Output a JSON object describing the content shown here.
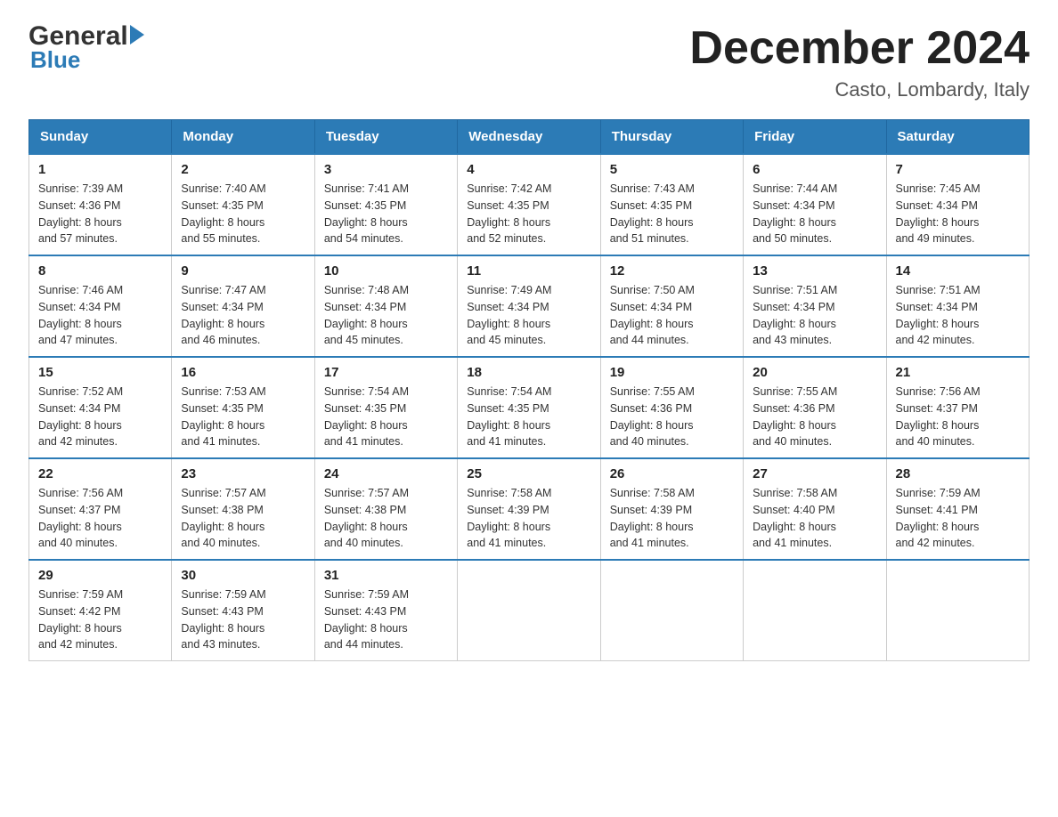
{
  "logo": {
    "general": "General",
    "blue": "Blue"
  },
  "title": {
    "month_year": "December 2024",
    "location": "Casto, Lombardy, Italy"
  },
  "headers": [
    "Sunday",
    "Monday",
    "Tuesday",
    "Wednesday",
    "Thursday",
    "Friday",
    "Saturday"
  ],
  "weeks": [
    [
      {
        "day": "1",
        "sunrise": "7:39 AM",
        "sunset": "4:36 PM",
        "daylight": "8 hours and 57 minutes."
      },
      {
        "day": "2",
        "sunrise": "7:40 AM",
        "sunset": "4:35 PM",
        "daylight": "8 hours and 55 minutes."
      },
      {
        "day": "3",
        "sunrise": "7:41 AM",
        "sunset": "4:35 PM",
        "daylight": "8 hours and 54 minutes."
      },
      {
        "day": "4",
        "sunrise": "7:42 AM",
        "sunset": "4:35 PM",
        "daylight": "8 hours and 52 minutes."
      },
      {
        "day": "5",
        "sunrise": "7:43 AM",
        "sunset": "4:35 PM",
        "daylight": "8 hours and 51 minutes."
      },
      {
        "day": "6",
        "sunrise": "7:44 AM",
        "sunset": "4:34 PM",
        "daylight": "8 hours and 50 minutes."
      },
      {
        "day": "7",
        "sunrise": "7:45 AM",
        "sunset": "4:34 PM",
        "daylight": "8 hours and 49 minutes."
      }
    ],
    [
      {
        "day": "8",
        "sunrise": "7:46 AM",
        "sunset": "4:34 PM",
        "daylight": "8 hours and 47 minutes."
      },
      {
        "day": "9",
        "sunrise": "7:47 AM",
        "sunset": "4:34 PM",
        "daylight": "8 hours and 46 minutes."
      },
      {
        "day": "10",
        "sunrise": "7:48 AM",
        "sunset": "4:34 PM",
        "daylight": "8 hours and 45 minutes."
      },
      {
        "day": "11",
        "sunrise": "7:49 AM",
        "sunset": "4:34 PM",
        "daylight": "8 hours and 45 minutes."
      },
      {
        "day": "12",
        "sunrise": "7:50 AM",
        "sunset": "4:34 PM",
        "daylight": "8 hours and 44 minutes."
      },
      {
        "day": "13",
        "sunrise": "7:51 AM",
        "sunset": "4:34 PM",
        "daylight": "8 hours and 43 minutes."
      },
      {
        "day": "14",
        "sunrise": "7:51 AM",
        "sunset": "4:34 PM",
        "daylight": "8 hours and 42 minutes."
      }
    ],
    [
      {
        "day": "15",
        "sunrise": "7:52 AM",
        "sunset": "4:34 PM",
        "daylight": "8 hours and 42 minutes."
      },
      {
        "day": "16",
        "sunrise": "7:53 AM",
        "sunset": "4:35 PM",
        "daylight": "8 hours and 41 minutes."
      },
      {
        "day": "17",
        "sunrise": "7:54 AM",
        "sunset": "4:35 PM",
        "daylight": "8 hours and 41 minutes."
      },
      {
        "day": "18",
        "sunrise": "7:54 AM",
        "sunset": "4:35 PM",
        "daylight": "8 hours and 41 minutes."
      },
      {
        "day": "19",
        "sunrise": "7:55 AM",
        "sunset": "4:36 PM",
        "daylight": "8 hours and 40 minutes."
      },
      {
        "day": "20",
        "sunrise": "7:55 AM",
        "sunset": "4:36 PM",
        "daylight": "8 hours and 40 minutes."
      },
      {
        "day": "21",
        "sunrise": "7:56 AM",
        "sunset": "4:37 PM",
        "daylight": "8 hours and 40 minutes."
      }
    ],
    [
      {
        "day": "22",
        "sunrise": "7:56 AM",
        "sunset": "4:37 PM",
        "daylight": "8 hours and 40 minutes."
      },
      {
        "day": "23",
        "sunrise": "7:57 AM",
        "sunset": "4:38 PM",
        "daylight": "8 hours and 40 minutes."
      },
      {
        "day": "24",
        "sunrise": "7:57 AM",
        "sunset": "4:38 PM",
        "daylight": "8 hours and 40 minutes."
      },
      {
        "day": "25",
        "sunrise": "7:58 AM",
        "sunset": "4:39 PM",
        "daylight": "8 hours and 41 minutes."
      },
      {
        "day": "26",
        "sunrise": "7:58 AM",
        "sunset": "4:39 PM",
        "daylight": "8 hours and 41 minutes."
      },
      {
        "day": "27",
        "sunrise": "7:58 AM",
        "sunset": "4:40 PM",
        "daylight": "8 hours and 41 minutes."
      },
      {
        "day": "28",
        "sunrise": "7:59 AM",
        "sunset": "4:41 PM",
        "daylight": "8 hours and 42 minutes."
      }
    ],
    [
      {
        "day": "29",
        "sunrise": "7:59 AM",
        "sunset": "4:42 PM",
        "daylight": "8 hours and 42 minutes."
      },
      {
        "day": "30",
        "sunrise": "7:59 AM",
        "sunset": "4:43 PM",
        "daylight": "8 hours and 43 minutes."
      },
      {
        "day": "31",
        "sunrise": "7:59 AM",
        "sunset": "4:43 PM",
        "daylight": "8 hours and 44 minutes."
      },
      null,
      null,
      null,
      null
    ]
  ],
  "labels": {
    "sunrise": "Sunrise:",
    "sunset": "Sunset:",
    "daylight": "Daylight:"
  }
}
